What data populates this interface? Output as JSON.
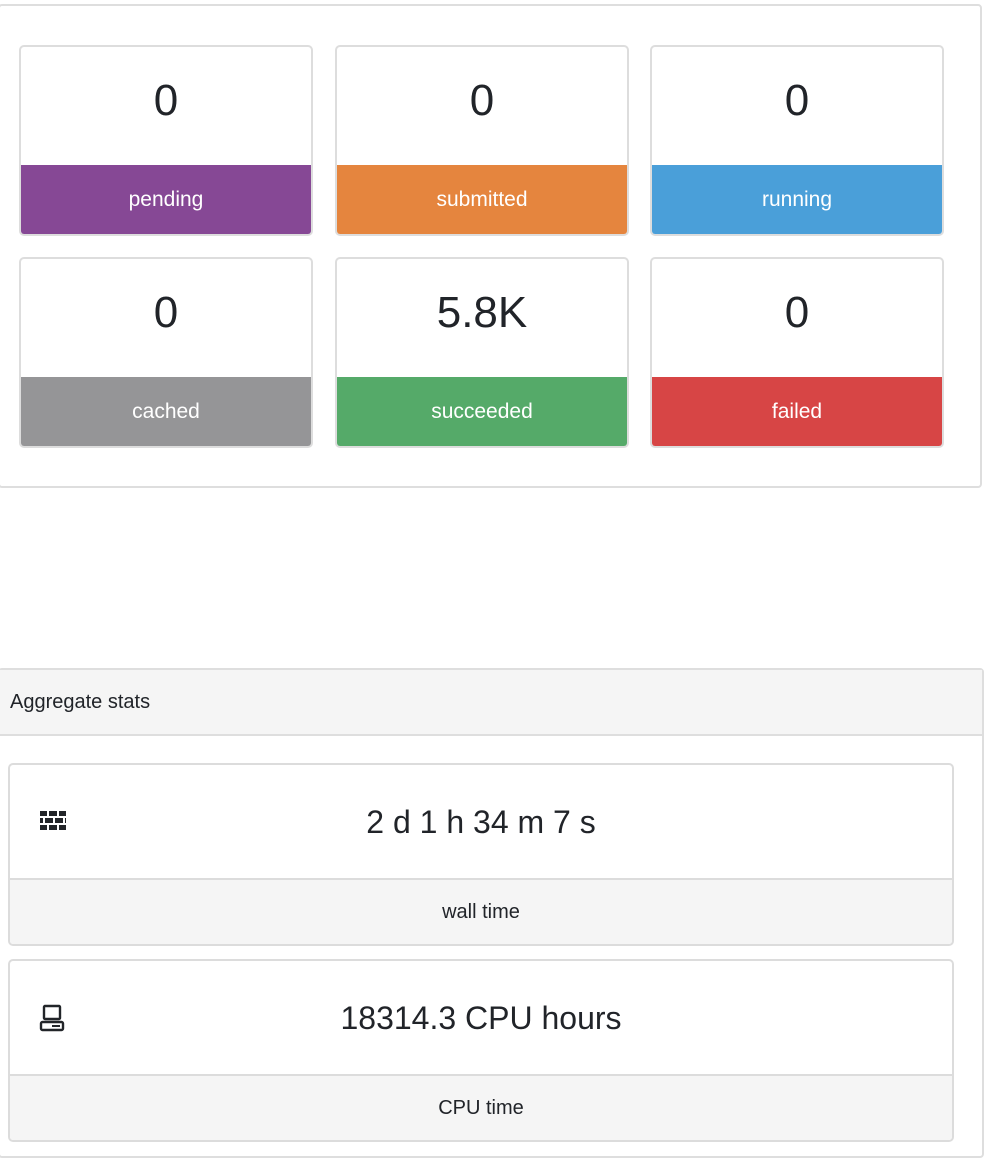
{
  "status_tiles": [
    {
      "id": "pending",
      "count": "0",
      "label": "pending",
      "color": "#864895"
    },
    {
      "id": "submitted",
      "count": "0",
      "label": "submitted",
      "color": "#e5853e"
    },
    {
      "id": "running",
      "count": "0",
      "label": "running",
      "color": "#4a9fd9"
    },
    {
      "id": "cached",
      "count": "0",
      "label": "cached",
      "color": "#959597"
    },
    {
      "id": "succeeded",
      "count": "5.8K",
      "label": "succeeded",
      "color": "#55aa69"
    },
    {
      "id": "failed",
      "count": "0",
      "label": "failed",
      "color": "#d74545"
    }
  ],
  "aggregate": {
    "title": "Aggregate stats",
    "wall_time": {
      "icon": "brick-wall-icon",
      "value": "2 d 1 h 34 m 7 s",
      "label": "wall time"
    },
    "cpu_time": {
      "icon": "computer-icon",
      "value": "18314.3 CPU hours",
      "label": "CPU time"
    }
  }
}
